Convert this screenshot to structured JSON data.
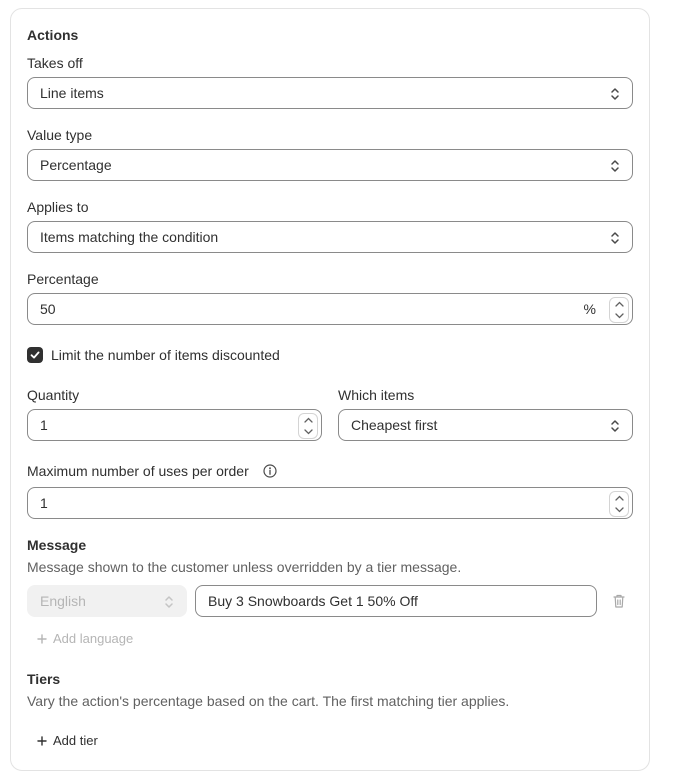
{
  "actions": {
    "title": "Actions",
    "takes_off": {
      "label": "Takes off",
      "value": "Line items"
    },
    "value_type": {
      "label": "Value type",
      "value": "Percentage"
    },
    "applies_to": {
      "label": "Applies to",
      "value": "Items matching the condition"
    },
    "percentage": {
      "label": "Percentage",
      "value": "50",
      "suffix": "%"
    },
    "limit_checkbox": {
      "label": "Limit the number of items discounted",
      "checked": true
    },
    "quantity": {
      "label": "Quantity",
      "value": "1"
    },
    "which_items": {
      "label": "Which items",
      "value": "Cheapest first"
    },
    "max_uses": {
      "label": "Maximum number of uses per order",
      "value": "1"
    }
  },
  "message": {
    "title": "Message",
    "help": "Message shown to the customer unless overridden by a tier message.",
    "language": "English",
    "text": "Buy 3 Snowboards Get 1 50% Off",
    "add_language": "Add language"
  },
  "tiers": {
    "title": "Tiers",
    "help": "Vary the action's percentage based on the cart. The first matching tier applies.",
    "add_tier": "Add tier"
  },
  "icons": {
    "select": "chevron-up-down-icon",
    "stepper": "stepper-arrows-icon",
    "info": "info-icon",
    "delete": "trash-icon",
    "add": "plus-icon",
    "check": "checkmark-icon"
  }
}
